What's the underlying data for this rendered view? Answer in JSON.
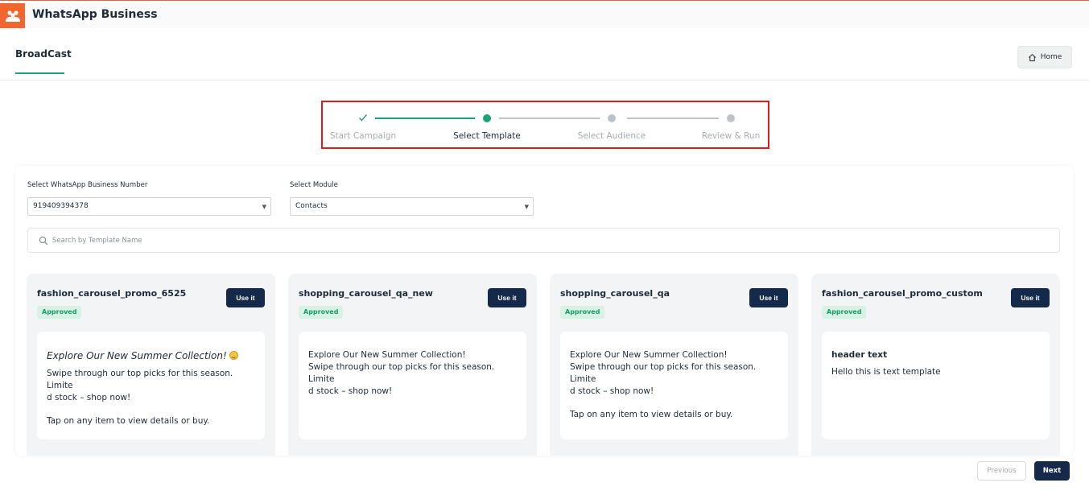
{
  "app": {
    "title": "WhatsApp Business"
  },
  "header": {
    "tab_label": "BroadCast",
    "home_label": "Home"
  },
  "stepper": {
    "steps": [
      {
        "label": "Start Campaign",
        "state": "done"
      },
      {
        "label": "Select Template",
        "state": "active"
      },
      {
        "label": "Select Audience",
        "state": "pending"
      },
      {
        "label": "Review & Run",
        "state": "pending"
      }
    ]
  },
  "filters": {
    "number_label": "Select WhatsApp Business Number",
    "number_value": "919409394378",
    "module_label": "Select Module",
    "module_value": "Contacts",
    "search_placeholder": "Search by Template Name"
  },
  "cards": [
    {
      "name": "fashion_carousel_promo_6525",
      "status": "Approved",
      "use_label": "Use it",
      "heading": "Explore Our New Summer Collection!",
      "line1": "Swipe through our top picks for this season. Limite",
      "line2": "d stock – shop now!",
      "line3": "Tap on any item to view details or buy."
    },
    {
      "name": "shopping_carousel_qa_new",
      "status": "Approved",
      "use_label": "Use it",
      "line1": "Explore Our New Summer Collection!",
      "line2": "Swipe through our top picks for this season. Limite",
      "line3": "d stock – shop now!"
    },
    {
      "name": "shopping_carousel_qa",
      "status": "Approved",
      "use_label": "Use it",
      "line1": "Explore Our New Summer Collection!",
      "line2": "Swipe through our top picks for this season. Limite",
      "line3": "d stock – shop now!",
      "line4": "Tap on any item to view details or buy."
    },
    {
      "name": "fashion_carousel_promo_custom",
      "status": "Approved",
      "use_label": "Use it",
      "header_text": "header text",
      "line1": "Hello this is text template"
    }
  ],
  "footer": {
    "previous_label": "Previous",
    "next_label": "Next"
  },
  "colors": {
    "accent": "#1aa37a",
    "brand": "#f1652f",
    "dark_button": "#15294a",
    "highlight_border": "#e01b1b"
  }
}
